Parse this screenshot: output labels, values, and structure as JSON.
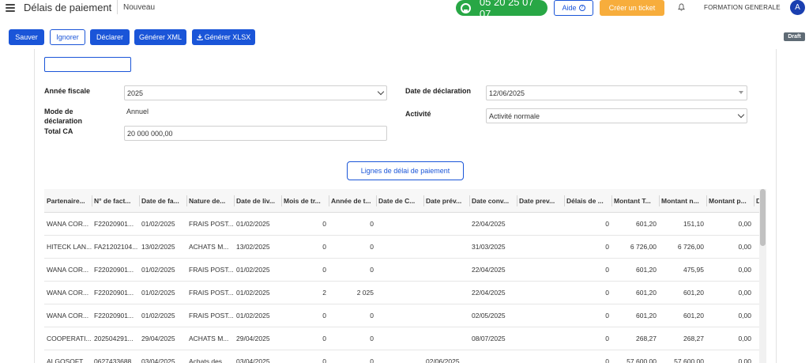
{
  "header": {
    "app_title": "Délais de paiement",
    "breadcrumb": "Nouveau",
    "phone": "05 20 25 07 07",
    "help_label": "Aide",
    "help_icon": "?",
    "ticket_label": "Créer un ticket",
    "company": "FORMATION GENERALE",
    "avatar_letter": "A"
  },
  "toolbar": {
    "save_label": "Sauver",
    "ignore_label": "Ignorer",
    "declare_label": "Déclarer",
    "xml_label": "Générer XML",
    "xlsx_label": "Générer XLSX",
    "status_badge": "Draft"
  },
  "form": {
    "fiscal_year_label": "Année fiscale",
    "fiscal_year_value": "2025",
    "declaration_mode_label": "Mode de déclaration",
    "declaration_mode_value": "Annuel",
    "total_ca_label": "Total CA",
    "total_ca_value": "20 000 000,00",
    "declaration_date_label": "Date de déclaration",
    "declaration_date_value": "12/06/2025",
    "activity_label": "Activité",
    "activity_value": "Activité normale"
  },
  "lines_button": "Lignes de délai de paiement",
  "table": {
    "columns": [
      "Partenaire...",
      "N° de fact...",
      "Date de fa...",
      "Nature de...",
      "Date de liv...",
      "Mois de tr...",
      "Année de t...",
      "Date de C...",
      "Date prév...",
      "Date conv...",
      "Date prev...",
      "Délais de ...",
      "Montant T...",
      "Montant n...",
      "Montant p...",
      "D"
    ],
    "rows": [
      [
        "WANA COR...",
        "F22020901...",
        "01/02/2025",
        "FRAIS POST...",
        "01/02/2025",
        "0",
        "0",
        "",
        "",
        "22/04/2025",
        "",
        "0",
        "601,20",
        "151,10",
        "0,00",
        ""
      ],
      [
        "HITECK LAN...",
        "FA21202104...",
        "13/02/2025",
        "ACHATS M...",
        "13/02/2025",
        "0",
        "0",
        "",
        "",
        "31/03/2025",
        "",
        "0",
        "6 726,00",
        "6 726,00",
        "0,00",
        ""
      ],
      [
        "WANA COR...",
        "F22020901...",
        "01/02/2025",
        "FRAIS POST...",
        "01/02/2025",
        "0",
        "0",
        "",
        "",
        "22/04/2025",
        "",
        "0",
        "601,20",
        "475,95",
        "0,00",
        ""
      ],
      [
        "WANA COR...",
        "F22020901...",
        "01/02/2025",
        "FRAIS POST...",
        "01/02/2025",
        "2",
        "2 025",
        "",
        "",
        "22/04/2025",
        "",
        "0",
        "601,20",
        "601,20",
        "0,00",
        ""
      ],
      [
        "WANA COR...",
        "F22020901...",
        "01/02/2025",
        "FRAIS POST...",
        "01/02/2025",
        "0",
        "0",
        "",
        "",
        "02/05/2025",
        "",
        "0",
        "601,20",
        "601,20",
        "0,00",
        ""
      ],
      [
        "COOPERATI...",
        "202504291...",
        "29/04/2025",
        "ACHATS M...",
        "29/04/2025",
        "0",
        "0",
        "",
        "",
        "08/07/2025",
        "",
        "0",
        "268,27",
        "268,27",
        "0,00",
        ""
      ],
      [
        "ALGOSOFT",
        "0627433688",
        "03/04/2025",
        "Achats des...",
        "03/04/2025",
        "0",
        "0",
        "",
        "02/06/2025",
        "",
        "",
        "0",
        "57 600,00",
        "57 600,00",
        "0,00",
        ""
      ]
    ]
  }
}
